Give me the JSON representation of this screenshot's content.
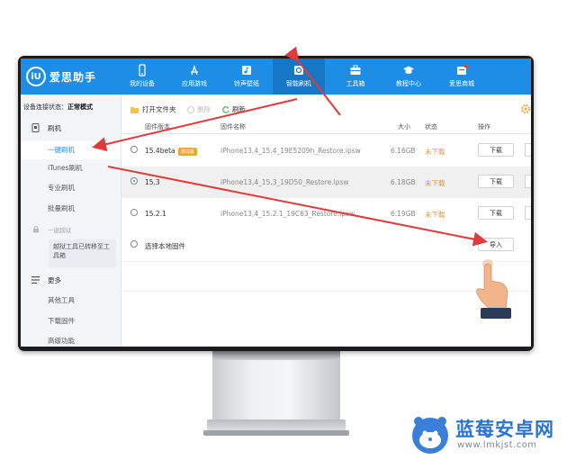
{
  "app": {
    "logo_mark": "iU",
    "logo_text": "爱思助手"
  },
  "nav": [
    {
      "label": "我的设备",
      "icon": "phone-icon"
    },
    {
      "label": "应用游戏",
      "icon": "app-store-icon"
    },
    {
      "label": "铃声壁纸",
      "icon": "music-icon"
    },
    {
      "label": "智能刷机",
      "icon": "flash-icon",
      "active": true
    },
    {
      "label": "工具箱",
      "icon": "toolbox-icon"
    },
    {
      "label": "教程中心",
      "icon": "graduation-cap-icon"
    },
    {
      "label": "爱思商城",
      "icon": "shop-icon"
    }
  ],
  "sidebar": {
    "connection_label": "设备连接状态：",
    "connection_value": "正常模式",
    "flash_header": "刷机",
    "items": [
      "一键刷机",
      "iTunes刷机",
      "专业刷机",
      "批量刷机"
    ],
    "jailbreak_header": "一键越狱",
    "jailbreak_note": "越狱工具已转移至工具箱",
    "more_header": "更多",
    "more_items": [
      "其他工具",
      "下载固件",
      "高级功能"
    ]
  },
  "toolbar": {
    "open_folder": "打开文件夹",
    "delete": "删除",
    "refresh": "刷新"
  },
  "table": {
    "headers": {
      "version": "固件版本",
      "name": "固件名称",
      "size": "大小",
      "status": "状态",
      "action": "操作"
    },
    "rows": [
      {
        "version": "15.4beta",
        "badge": "测试版",
        "name": "iPhone13,4_15.4_19E5209h_Restore.ipsw",
        "size": "6.16GB",
        "status": "未下载",
        "action": "下载",
        "selected": false
      },
      {
        "version": "15.3",
        "badge": "",
        "name": "iPhone13,4_15.3_19D50_Restore.ipsw",
        "size": "6.18GB",
        "status": "未下载",
        "action": "下载",
        "selected": true
      },
      {
        "version": "15.2.1",
        "badge": "",
        "name": "iPhone13,4_15.2.1_19C63_Restore.ipsw",
        "size": "6.19GB",
        "status": "未下载",
        "action": "下载",
        "selected": false
      }
    ],
    "local_label": "选择本地固件",
    "import_label": "导入"
  },
  "watermark": {
    "text": "蓝莓安卓网",
    "url": "www.lmkjst.com"
  },
  "colors": {
    "brand": "#1e8de6",
    "annotation": "#e2393b",
    "status_pending": "#e59b2e"
  }
}
